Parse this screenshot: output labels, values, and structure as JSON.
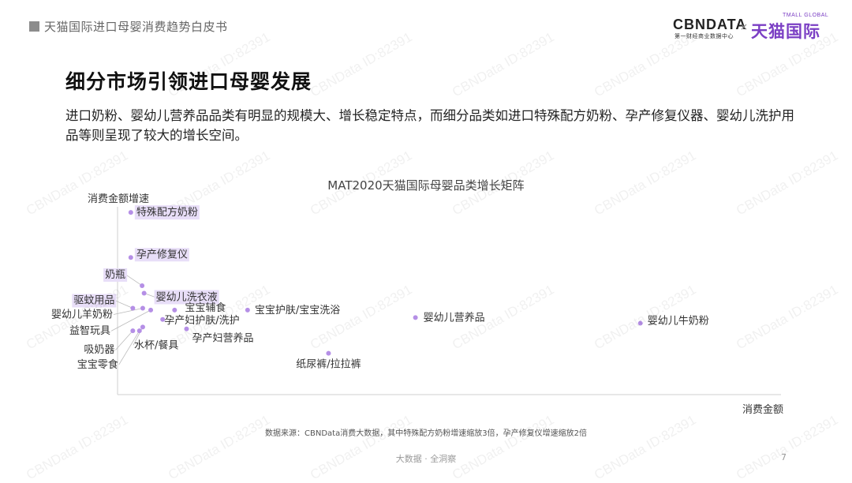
{
  "header": {
    "report_title": "天猫国际进口母婴消费趋势白皮书",
    "brand_cbn": "CBNDATA",
    "brand_cbn_sub": "第一财经商业数据中心",
    "brand_sep": "×",
    "brand_tmall_small": "TMALL GLOBAL",
    "brand_tmall": "天猫国际"
  },
  "page": {
    "title": "细分市场引领进口母婴发展",
    "subtitle": "进口奶粉、婴幼儿营养品品类有明显的规模大、增长稳定特点，而细分品类如进口特殊配方奶粉、孕产修复仪器、婴幼儿洗护用品等则呈现了较大的增长空间。",
    "source_note": "数据来源：CBNData消费大数据，其中特殊配方奶粉增速缩放3倍，孕产修复仪增速缩放2倍",
    "footer": "大数据 · 全洞察",
    "page_number": "7"
  },
  "watermark": "CBNData ID:82391",
  "colors": {
    "point": "#b58fe6",
    "highlight_bg": "#e8def8",
    "accent": "#7b3fc4"
  },
  "chart_data": {
    "type": "scatter",
    "title": "MAT2020天猫国际母婴品类增长矩阵",
    "xlabel": "消费金额",
    "ylabel": "消费金额增速",
    "xlim": [
      0,
      100
    ],
    "ylim": [
      0,
      100
    ],
    "grid": false,
    "points": [
      {
        "label": "特殊配方奶粉",
        "x": 2.0,
        "y": 97,
        "highlight": true
      },
      {
        "label": "孕产修复仪",
        "x": 2.0,
        "y": 73,
        "highlight": true
      },
      {
        "label": "奶瓶",
        "x": 3.7,
        "y": 58,
        "highlight": true
      },
      {
        "label": "婴幼儿洗衣液",
        "x": 4.0,
        "y": 54,
        "highlight": true
      },
      {
        "label": "驱蚊用品",
        "x": 2.3,
        "y": 46,
        "highlight": true
      },
      {
        "label": "婴幼儿羊奶粉",
        "x": 3.8,
        "y": 46,
        "highlight": false
      },
      {
        "label": "益智玩具",
        "x": 5.0,
        "y": 45,
        "highlight": false
      },
      {
        "label": "宝宝辅食",
        "x": 8.6,
        "y": 45,
        "highlight": false
      },
      {
        "label": "宝宝护肤/宝宝洗浴",
        "x": 19.6,
        "y": 45,
        "highlight": false
      },
      {
        "label": "孕产妇护肤/洗护",
        "x": 6.8,
        "y": 40,
        "highlight": false
      },
      {
        "label": "孕产妇营养品",
        "x": 10.4,
        "y": 35,
        "highlight": false
      },
      {
        "label": "吸奶器",
        "x": 2.3,
        "y": 34,
        "highlight": false
      },
      {
        "label": "宝宝零食",
        "x": 3.3,
        "y": 34,
        "highlight": false
      },
      {
        "label": "水杯/餐具",
        "x": 3.8,
        "y": 36,
        "highlight": false
      },
      {
        "label": "婴幼儿营养品",
        "x": 44.9,
        "y": 41,
        "highlight": false
      },
      {
        "label": "纸尿裤/拉拉裤",
        "x": 31.8,
        "y": 22,
        "highlight": false
      },
      {
        "label": "婴幼儿牛奶粉",
        "x": 78.8,
        "y": 38,
        "highlight": false
      }
    ]
  }
}
